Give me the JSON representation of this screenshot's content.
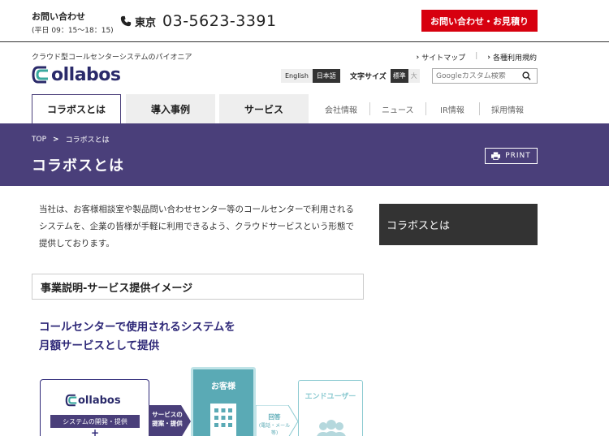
{
  "topbar": {
    "contact_label": "お問い合わせ",
    "hours": "(平日 09：15〜18：15)",
    "phone_area": "東京",
    "phone_number": "03-5623-3391",
    "cta_label": "お問い合わせ・お見積り",
    "cta_color": "#d7000f"
  },
  "header": {
    "tagline": "クラウド型コールセンターシステムのパイオニア",
    "logo_text": "ollabos",
    "util_links": [
      {
        "label": "サイトマップ"
      },
      {
        "label": "各種利用規約"
      }
    ],
    "lang": {
      "en": "English",
      "ja": "日本語"
    },
    "fontsize": {
      "label": "文字サイズ",
      "standard": "標準",
      "large": "大"
    },
    "search_placeholder": "Googleカスタム検索"
  },
  "nav": {
    "main": [
      "コラボスとは",
      "導入事例",
      "サービス"
    ],
    "sub": [
      "会社情報",
      "ニュース",
      "IR情報",
      "採用情報"
    ]
  },
  "band": {
    "color": "#4a3f7a",
    "breadcrumb_top": "TOP",
    "breadcrumb_current": "コラボスとは",
    "title": "コラボスとは",
    "print_label": "PRINT"
  },
  "content": {
    "intro_lines": [
      "当社は、お客様相談室や製品問い合わせセンター等のコールセンターで利用される",
      "システムを、企業の皆様が手軽に利用できるよう、クラウドサービスという形態で",
      "提供しております。"
    ],
    "side_box": "コラボスとは",
    "section_heading": "事業説明-サービス提供イメージ",
    "lead_lines": [
      "コールセンターで使用されるシステムを",
      "月額サービスとして提供"
    ]
  },
  "diagram": {
    "logo_text": "ollabos",
    "dev_label": "システムの開発・提供",
    "plus": "+",
    "arrow1_lines": [
      "サービスの",
      "提案・提供"
    ],
    "client_label": "お客様",
    "arrow2_main": "回答",
    "arrow2_sub": "(電話・メール等)",
    "enduser_label": "エンドユーザー"
  }
}
